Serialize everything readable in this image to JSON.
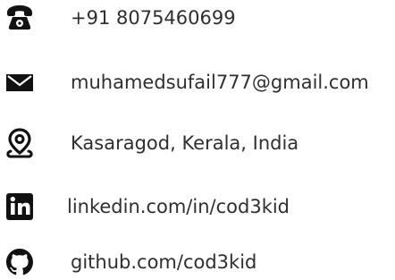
{
  "contacts": {
    "phone": {
      "icon": "phone-icon",
      "text": "+91 8075460699"
    },
    "email": {
      "icon": "envelope-icon",
      "text": "muhamedsufail777@gmail.com"
    },
    "location": {
      "icon": "location-pin-icon",
      "text": "Kasaragod, Kerala, India"
    },
    "linkedin": {
      "icon": "linkedin-icon",
      "text": "linkedin.com/in/cod3kid"
    },
    "github": {
      "icon": "github-icon",
      "text": "github.com/cod3kid"
    }
  },
  "colors": {
    "icon": "#111111",
    "text": "#2f2f2f"
  }
}
